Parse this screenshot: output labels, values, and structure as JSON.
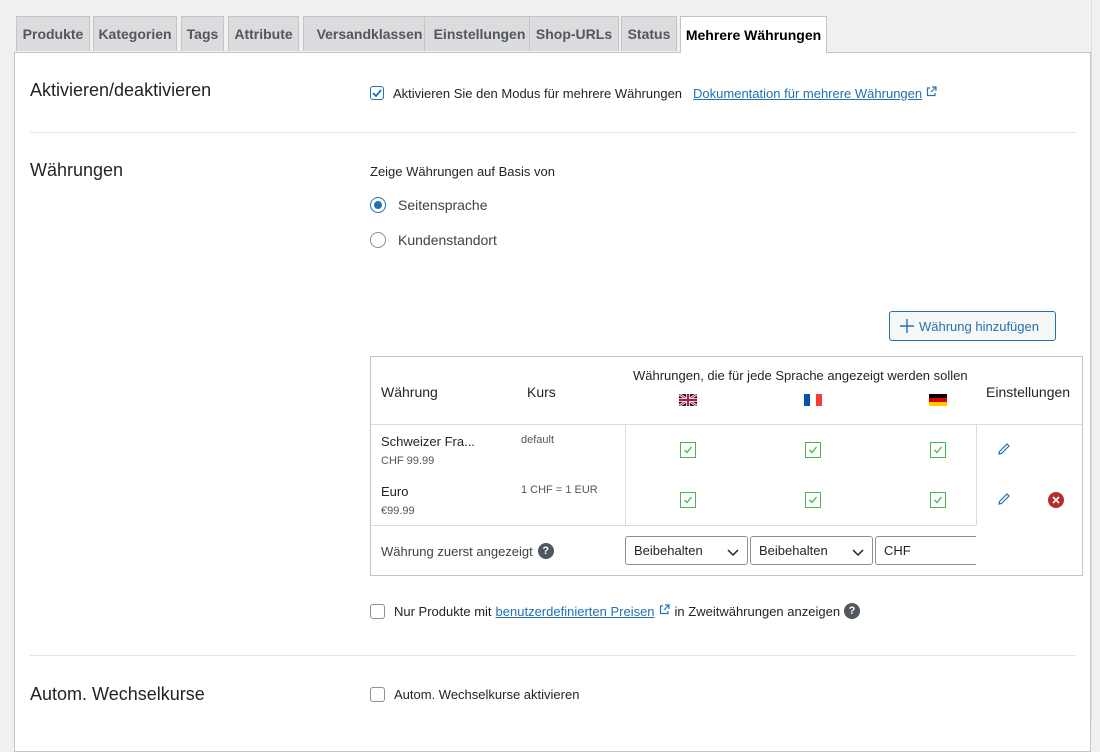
{
  "tabs": [
    {
      "label": "Produkte"
    },
    {
      "label": "Kategorien"
    },
    {
      "label": "Tags"
    },
    {
      "label": "Attribute"
    },
    {
      "label": "Versandklassen"
    },
    {
      "label": "Einstellungen"
    },
    {
      "label": "Shop-URLs"
    },
    {
      "label": "Status"
    },
    {
      "label": "Mehrere Währungen",
      "active": true
    }
  ],
  "section_enable": {
    "title": "Aktivieren/deaktivieren",
    "checkbox_label": "Aktivieren Sie den Modus für mehrere Währungen",
    "checkbox_checked": true,
    "doc_link": "Dokumentation für mehrere Währungen"
  },
  "section_currencies": {
    "title": "Währungen",
    "basis_label": "Zeige Währungen auf Basis von",
    "radio_options": [
      {
        "label": "Seitensprache",
        "checked": true
      },
      {
        "label": "Kundenstandort",
        "checked": false
      }
    ],
    "add_button": "Währung hinzufügen",
    "table": {
      "col_currency": "Währung",
      "col_rate": "Kurs",
      "col_languages": "Währungen, die für jede Sprache angezeigt werden sollen",
      "col_settings": "Einstellungen",
      "flags": [
        "english-flag",
        "french-flag",
        "german-flag"
      ],
      "rows": [
        {
          "name": "Schweizer Fra...",
          "price": "CHF 99.99",
          "rate": "default",
          "checks": [
            true,
            true,
            true
          ],
          "deletable": false
        },
        {
          "name": "Euro",
          "price": "€99.99",
          "rate": "1 CHF = 1 EUR",
          "checks": [
            true,
            true,
            true
          ],
          "deletable": true
        }
      ],
      "first_shown_label": "Währung zuerst angezeigt",
      "first_shown_values": [
        "Beibehalten",
        "Beibehalten",
        "CHF"
      ]
    },
    "custom_prices": {
      "prefix": "Nur Produkte mit",
      "link": "benutzerdefinierten Preisen",
      "suffix": "in Zweitwährungen anzeigen",
      "checked": false
    }
  },
  "section_rates": {
    "title": "Autom. Wechselkurse",
    "checkbox_label": "Autom. Wechselkurse aktivieren",
    "checkbox_checked": false
  },
  "colors": {
    "accent": "#2271b1",
    "check_green": "#46b450",
    "delete_red": "#b32d2e"
  }
}
